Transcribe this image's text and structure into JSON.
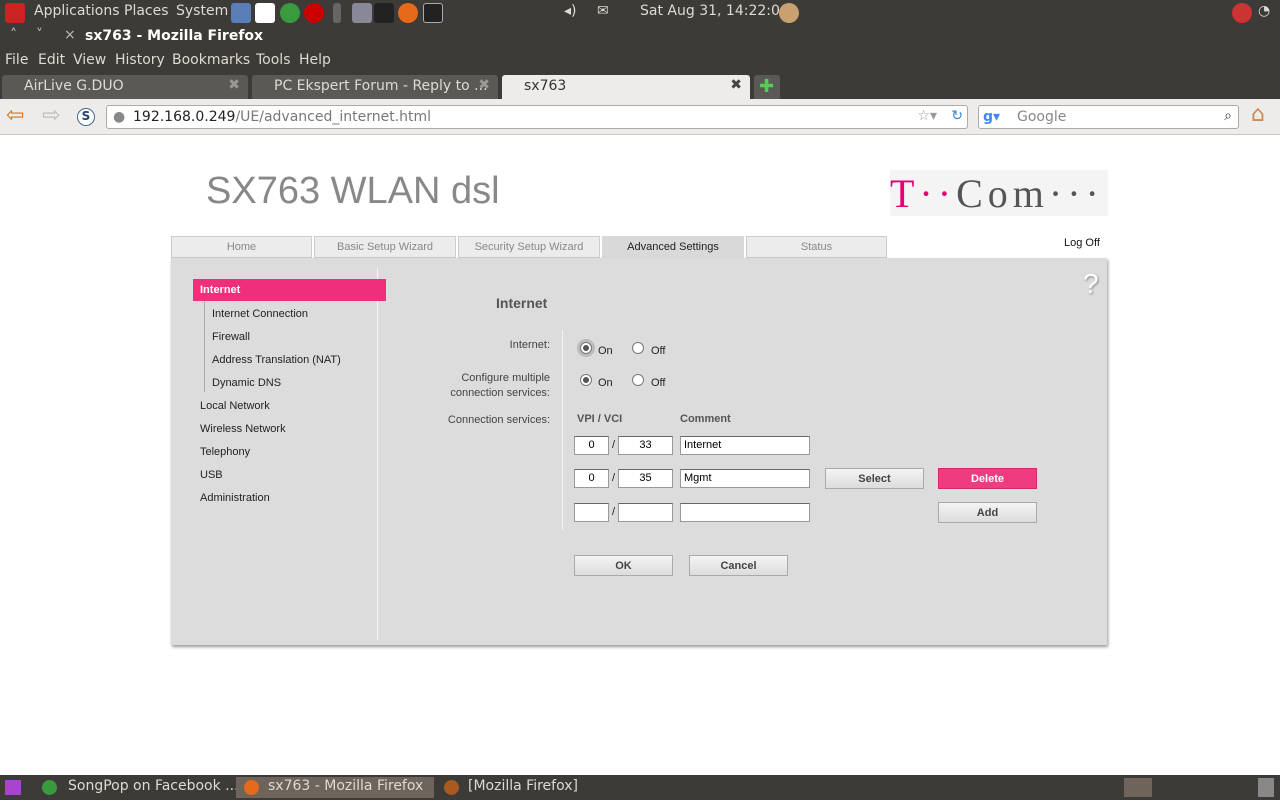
{
  "panel": {
    "menus": [
      "Applications",
      "Places",
      "System"
    ],
    "clock": "Sat Aug 31, 14:22:06"
  },
  "window": {
    "title": "sx763 - Mozilla Firefox"
  },
  "menubar": [
    "File",
    "Edit",
    "View",
    "History",
    "Bookmarks",
    "Tools",
    "Help"
  ],
  "tabs": [
    {
      "label": "AirLive G.DUO"
    },
    {
      "label": "PC Ekspert Forum - Reply to ..."
    },
    {
      "label": "sx763"
    }
  ],
  "nav": {
    "url_host": "192.168.0.249",
    "url_path": "/UE/advanced_internet.html",
    "search_placeholder": "Google"
  },
  "page": {
    "product": "SX763 WLAN dsl",
    "brand": "T··Com···",
    "logoff": "Log Off",
    "help": "?",
    "top_tabs": [
      "Home",
      "Basic Setup Wizard",
      "Security Setup Wizard",
      "Advanced Settings",
      "Status"
    ],
    "sidebar": {
      "active": "Internet",
      "sub": [
        "Internet Connection",
        "Firewall",
        "Address Translation (NAT)",
        "Dynamic DNS"
      ],
      "items": [
        "Local Network",
        "Wireless Network",
        "Telephony",
        "USB",
        "Administration"
      ]
    },
    "heading": "Internet",
    "labels": {
      "internet": "Internet:",
      "multi1": "Configure multiple",
      "multi2": "connection services:",
      "services": "Connection services:",
      "on": "On",
      "off": "Off",
      "vpivci": "VPI / VCI",
      "comment": "Comment",
      "slash": "/"
    },
    "rows": [
      {
        "vpi": "0",
        "vci": "33",
        "comment": "Internet"
      },
      {
        "vpi": "0",
        "vci": "35",
        "comment": "Mgmt"
      },
      {
        "vpi": "",
        "vci": "",
        "comment": ""
      }
    ],
    "buttons": {
      "select": "Select",
      "delete": "Delete",
      "add": "Add",
      "ok": "OK",
      "cancel": "Cancel"
    }
  },
  "taskbar": [
    "SongPop on Facebook ...",
    "sx763 - Mozilla Firefox",
    "[Mozilla Firefox]"
  ]
}
